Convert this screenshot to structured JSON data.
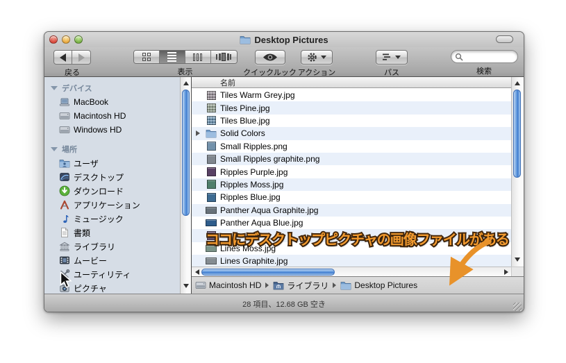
{
  "colors": {
    "stripe_blue": "#e9f0fa",
    "scrollbar_blue": "#4a84d4",
    "annotation_orange": "#f29a2e",
    "annotation_outline": "#45290e",
    "arrow_orange": "#e8922a",
    "sidebar_bg": "#d6dde6"
  },
  "titlebar": {
    "title": "Desktop Pictures"
  },
  "toolbar": {
    "back_label": "戻る",
    "view_label": "表示",
    "quicklook_label": "クイックルック",
    "action_label": "アクション",
    "path_label": "パス",
    "search_label": "検索",
    "search_value": ""
  },
  "sidebar": {
    "sections": [
      {
        "header": "デバイス",
        "items": [
          {
            "id": "macbook",
            "label": "MacBook",
            "icon": "laptop-icon"
          },
          {
            "id": "macintosh-hd",
            "label": "Macintosh HD",
            "icon": "hard-drive-icon"
          },
          {
            "id": "windows-hd",
            "label": "Windows HD",
            "icon": "hard-drive-icon"
          }
        ]
      },
      {
        "header": "場所",
        "items": [
          {
            "id": "users",
            "label": "ユーザ",
            "icon": "users-folder-icon"
          },
          {
            "id": "desktop",
            "label": "デスクトップ",
            "icon": "desktop-icon"
          },
          {
            "id": "downloads",
            "label": "ダウンロード",
            "icon": "downloads-icon"
          },
          {
            "id": "applications",
            "label": "アプリケーション",
            "icon": "applications-icon"
          },
          {
            "id": "music",
            "label": "ミュージック",
            "icon": "music-icon"
          },
          {
            "id": "documents",
            "label": "書類",
            "icon": "documents-icon"
          },
          {
            "id": "library",
            "label": "ライブラリ",
            "icon": "library-icon"
          },
          {
            "id": "movies",
            "label": "ムービー",
            "icon": "movies-icon"
          },
          {
            "id": "utilities",
            "label": "ユーティリティ",
            "icon": "utilities-icon"
          },
          {
            "id": "pictures",
            "label": "ピクチャ",
            "icon": "pictures-icon"
          }
        ]
      }
    ]
  },
  "list": {
    "column_header": "名前",
    "rows": [
      {
        "id": "tiles-warm-grey",
        "name": "Tiles Warm Grey.jpg",
        "icon": "image-thumbnail",
        "shape": "square",
        "color": "#938a92",
        "tiled": true
      },
      {
        "id": "tiles-pine",
        "name": "Tiles Pine.jpg",
        "icon": "image-thumbnail",
        "shape": "square",
        "color": "#8d9c8b",
        "tiled": true
      },
      {
        "id": "tiles-blue",
        "name": "Tiles Blue.jpg",
        "icon": "image-thumbnail",
        "shape": "square",
        "color": "#5d8aab",
        "tiled": true
      },
      {
        "id": "solid-colors",
        "name": "Solid Colors",
        "icon": "folder-icon",
        "expandable": true
      },
      {
        "id": "small-ripples",
        "name": "Small Ripples.png",
        "icon": "image-thumbnail",
        "shape": "square",
        "color": "#7392ab"
      },
      {
        "id": "small-ripples-graphite",
        "name": "Small Ripples graphite.png",
        "icon": "image-thumbnail",
        "shape": "square",
        "color": "#7f868e"
      },
      {
        "id": "ripples-purple",
        "name": "Ripples Purple.jpg",
        "icon": "image-thumbnail",
        "shape": "square",
        "color": "#594164"
      },
      {
        "id": "ripples-moss",
        "name": "Ripples Moss.jpg",
        "icon": "image-thumbnail",
        "shape": "square",
        "color": "#4e7e6b"
      },
      {
        "id": "ripples-blue",
        "name": "Ripples Blue.jpg",
        "icon": "image-thumbnail",
        "shape": "square",
        "color": "#3d6b92"
      },
      {
        "id": "panther-aqua-graphite",
        "name": "Panther Aqua Graphite.jpg",
        "icon": "image-thumbnail",
        "shape": "wide",
        "color": "#68727b"
      },
      {
        "id": "panther-aqua-blue",
        "name": "Panther Aqua Blue.jpg",
        "icon": "image-thumbnail",
        "shape": "wide",
        "color": "#2f5d8c"
      },
      {
        "id": "hidden-file",
        "name": "",
        "icon": "image-thumbnail",
        "shape": "square",
        "color": "#63536e"
      },
      {
        "id": "lines-moss",
        "name": "Lines Moss.jpg",
        "icon": "image-thumbnail",
        "shape": "wide",
        "color": "#7b9489"
      },
      {
        "id": "lines-graphite",
        "name": "Lines Graphite.jpg",
        "icon": "image-thumbnail",
        "shape": "wide",
        "color": "#848c92"
      }
    ]
  },
  "annotation": {
    "text": "ココにデスクトップピクチャの画像ファイルがある"
  },
  "pathbar": {
    "items": [
      {
        "id": "macintosh-hd",
        "label": "Macintosh HD",
        "icon": "hard-drive-icon"
      },
      {
        "id": "library",
        "label": "ライブラリ",
        "icon": "library-folder-icon"
      },
      {
        "id": "desktop-pictures",
        "label": "Desktop Pictures",
        "icon": "folder-icon"
      }
    ]
  },
  "statusbar": {
    "text": "28 項目、12.68 GB 空き"
  }
}
